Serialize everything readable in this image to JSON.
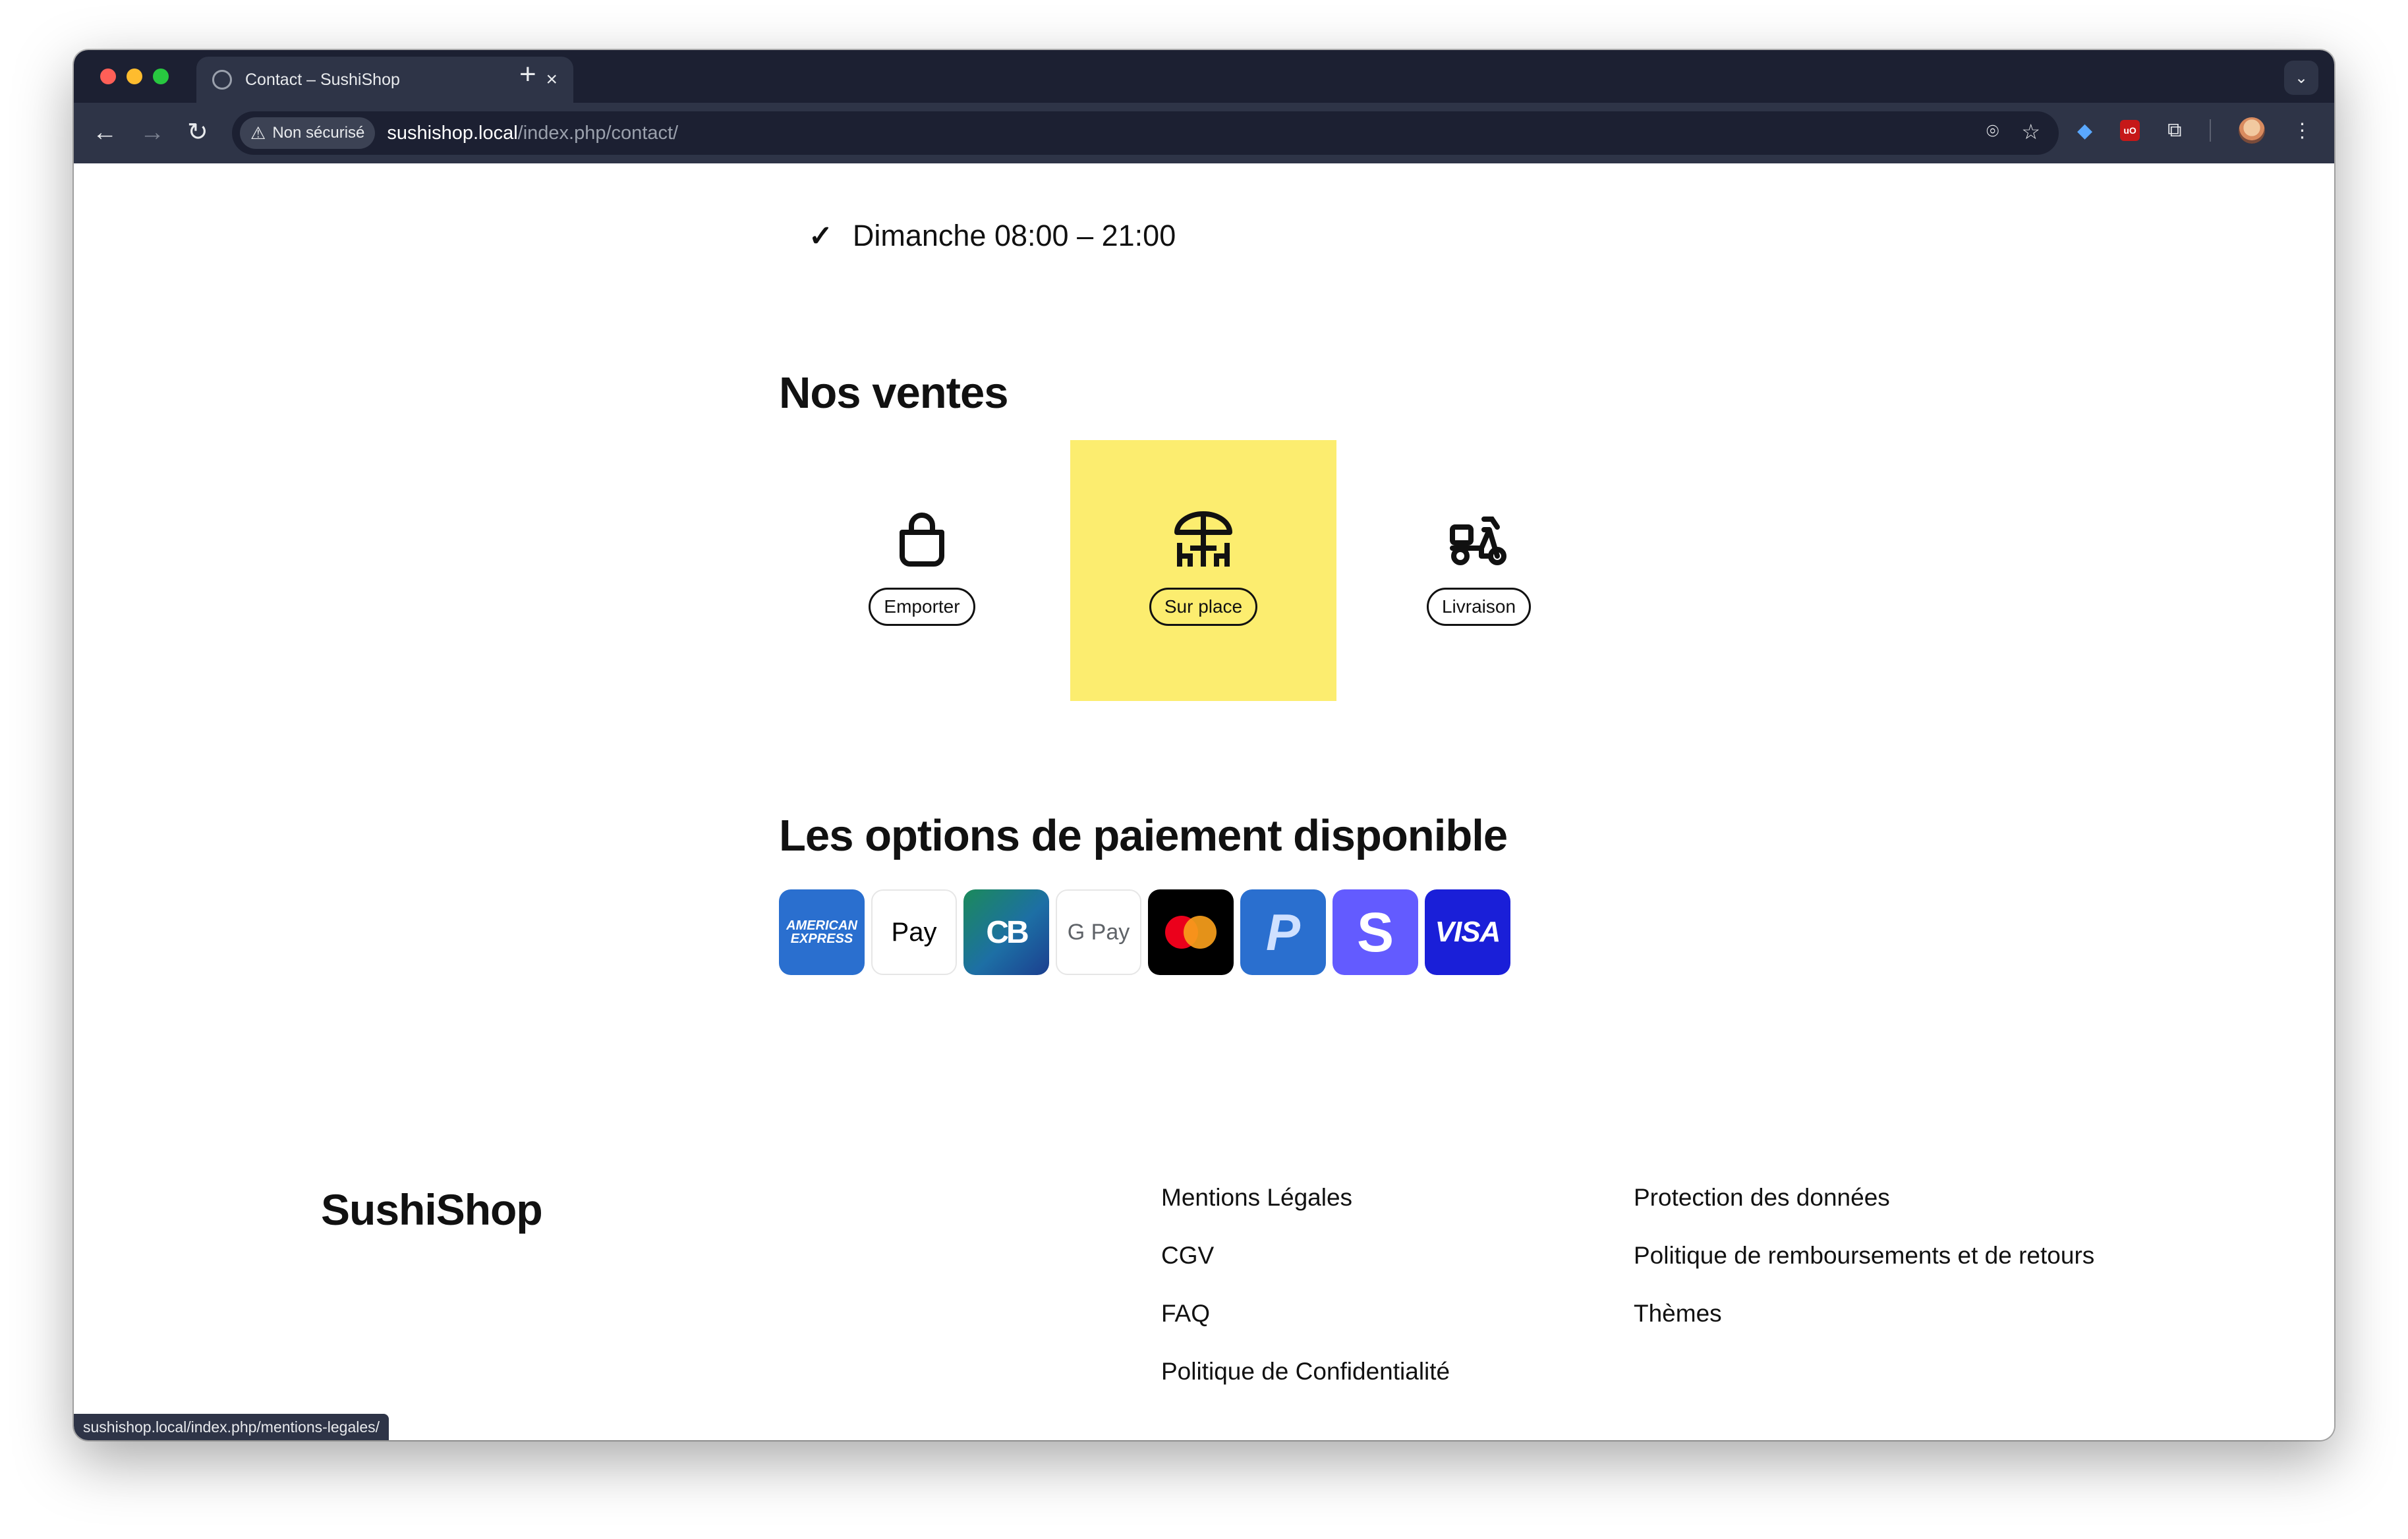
{
  "browser": {
    "tab_title": "Contact – SushiShop",
    "tab_close": "×",
    "new_tab": "+",
    "security_label": "Non sécurisé",
    "url_host": "sushishop.local",
    "url_path": "/index.php/contact/",
    "status_url": "sushishop.local/index.php/mentions-legales/"
  },
  "hours": {
    "last_line": "Dimanche 08:00 – 21:00"
  },
  "sales": {
    "title": "Nos ventes",
    "items": [
      {
        "label": "Emporter",
        "icon": "shopping-bag-icon",
        "active": false
      },
      {
        "label": "Sur place",
        "icon": "table-umbrella-icon",
        "active": true
      },
      {
        "label": "Livraison",
        "icon": "scooter-icon",
        "active": false
      }
    ],
    "active_color": "#fced6f"
  },
  "payments": {
    "title": "Les options de paiement disponible",
    "cards": [
      {
        "name": "American Express",
        "text": "AMERICAN EXPRESS"
      },
      {
        "name": "Apple Pay",
        "text": " Pay"
      },
      {
        "name": "Carte Bancaire",
        "text": "CB"
      },
      {
        "name": "Google Pay",
        "text": "G Pay"
      },
      {
        "name": "Mastercard",
        "text": ""
      },
      {
        "name": "PayPal",
        "text": "P"
      },
      {
        "name": "Stripe",
        "text": "S"
      },
      {
        "name": "Visa",
        "text": "VISA"
      }
    ]
  },
  "footer": {
    "brand": "SushiShop",
    "col1": [
      "Mentions Légales",
      "CGV",
      "FAQ",
      "Politique de Confidentialité"
    ],
    "col2": [
      "Protection des données",
      "Politique de remboursements et de retours",
      "Thèmes"
    ]
  }
}
